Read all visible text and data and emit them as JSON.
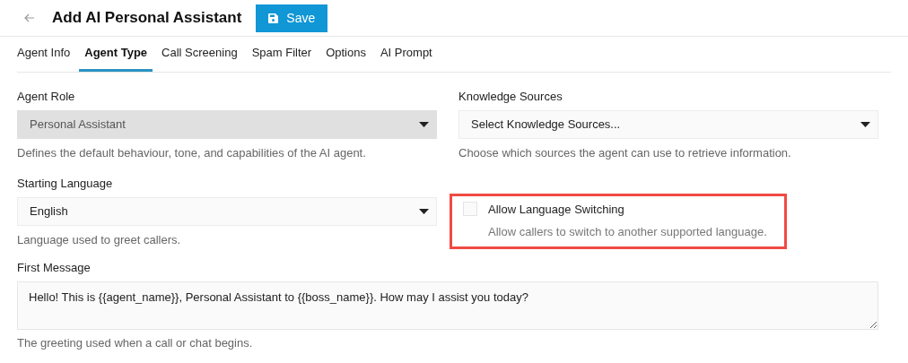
{
  "header": {
    "title": "Add AI Personal Assistant",
    "save_button": "Save"
  },
  "tabs": [
    {
      "label": "Agent Info",
      "selected": false
    },
    {
      "label": "Agent Type",
      "selected": true
    },
    {
      "label": "Call Screening",
      "selected": false
    },
    {
      "label": "Spam Filter",
      "selected": false
    },
    {
      "label": "Options",
      "selected": false
    },
    {
      "label": "AI Prompt",
      "selected": false
    }
  ],
  "agent_role": {
    "label": "Agent Role",
    "value": "Personal Assistant",
    "disabled": true,
    "help": "Defines the default behaviour, tone, and capabilities of the AI agent."
  },
  "knowledge_sources": {
    "label": "Knowledge Sources",
    "placeholder": "Select Knowledge Sources...",
    "disabled": false,
    "help": "Choose which sources the agent can use to retrieve information."
  },
  "starting_language": {
    "label": "Starting Language",
    "value": "English",
    "disabled": false,
    "help": "Language used to greet callers."
  },
  "language_switching": {
    "label": "Allow Language Switching",
    "help": "Allow callers to switch to another supported language.",
    "checked": false,
    "highlighted": true
  },
  "first_message": {
    "label": "First Message",
    "value": "Hello! This is {{agent_name}}, Personal Assistant to {{boss_name}}. How may I assist you today?",
    "help": "The greeting used when a call or chat begins."
  }
}
